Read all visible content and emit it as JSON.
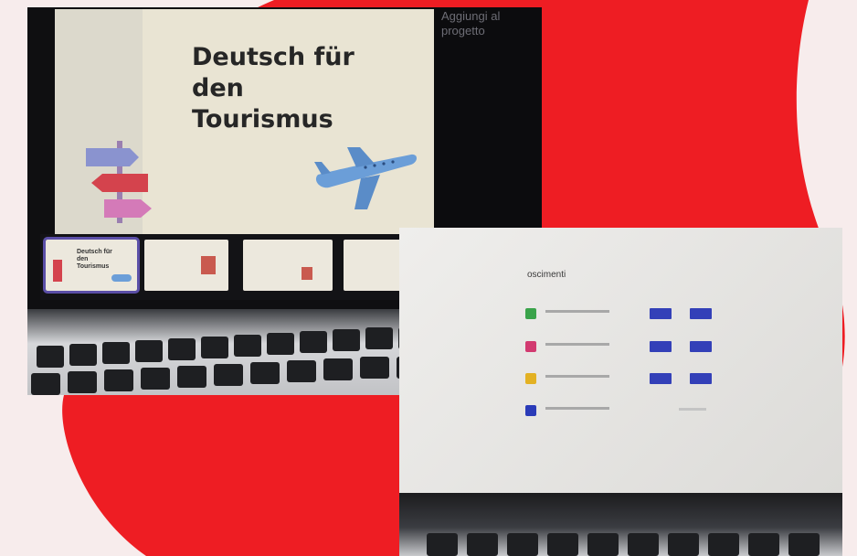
{
  "colors": {
    "background": "#f7ecec",
    "blob": "#ee1d23",
    "accent_blue": "#3340b8"
  },
  "photo_left": {
    "slide_title": "Deutsch für\nden\nTourismus",
    "side_panel_text": "Aggiungi al\nprogetto",
    "thumbnails": [
      {
        "label": "Deutsch für\nden\nTourismus",
        "selected": true
      },
      {
        "label": "",
        "selected": false
      },
      {
        "label": "",
        "selected": false
      },
      {
        "label": "",
        "selected": false
      }
    ],
    "icons": [
      "signpost-arrows-icon",
      "airplane-icon"
    ]
  },
  "photo_right": {
    "heading": "oscimenti",
    "rows": [
      {
        "icon_color": "#3aa34a",
        "has_buttons": true
      },
      {
        "icon_color": "#d23a70",
        "has_buttons": true
      },
      {
        "icon_color": "#e3b123",
        "has_buttons": true
      },
      {
        "icon_color": "#2a3bb8",
        "has_buttons": false
      }
    ]
  }
}
